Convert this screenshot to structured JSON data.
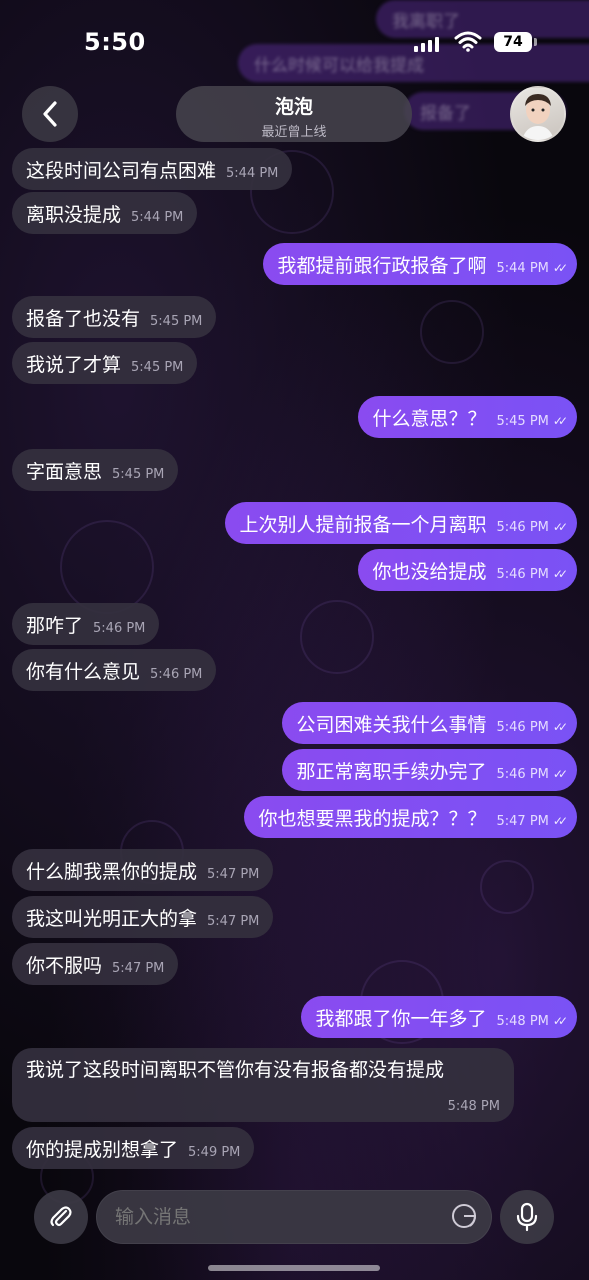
{
  "status": {
    "time": "5:50",
    "battery": "74"
  },
  "ghost_messages": [
    {
      "text": "我离职了"
    },
    {
      "text": "什么时候可以给我提成"
    },
    {
      "text": "报备了"
    }
  ],
  "header": {
    "name": "泡泡",
    "last_seen": "最近曾上线"
  },
  "messages": [
    {
      "side": "in",
      "text": "这段时间公司有点困难",
      "time": "5:44 PM"
    },
    {
      "side": "in",
      "text": "离职没提成",
      "time": "5:44 PM"
    },
    {
      "side": "out",
      "text": "我都提前跟行政报备了啊",
      "time": "5:44 PM"
    },
    {
      "side": "in",
      "text": "报备了也没有",
      "time": "5:45 PM"
    },
    {
      "side": "in",
      "text": "我说了才算",
      "time": "5:45 PM"
    },
    {
      "side": "out",
      "text": "什么意思？？",
      "time": "5:45 PM"
    },
    {
      "side": "in",
      "text": "字面意思",
      "time": "5:45 PM"
    },
    {
      "side": "out",
      "text": "上次别人提前报备一个月离职",
      "time": "5:46 PM"
    },
    {
      "side": "out",
      "text": "你也没给提成",
      "time": "5:46 PM"
    },
    {
      "side": "in",
      "text": "那咋了",
      "time": "5:46 PM"
    },
    {
      "side": "in",
      "text": "你有什么意见",
      "time": "5:46 PM"
    },
    {
      "side": "out",
      "text": "公司困难关我什么事情",
      "time": "5:46 PM"
    },
    {
      "side": "out",
      "text": "那正常离职手续办完了",
      "time": "5:46 PM"
    },
    {
      "side": "out",
      "text": "你也想要黑我的提成？？？",
      "time": "5:47 PM"
    },
    {
      "side": "in",
      "text": "什么脚我黑你的提成",
      "time": "5:47 PM"
    },
    {
      "side": "in",
      "text": "我这叫光明正大的拿",
      "time": "5:47 PM"
    },
    {
      "side": "in",
      "text": "你不服吗",
      "time": "5:47 PM"
    },
    {
      "side": "out",
      "text": "我都跟了你一年多了",
      "time": "5:48 PM"
    },
    {
      "side": "in",
      "text": "我说了这段时间离职不管你有没有报备都没有提成",
      "time": "5:48 PM"
    },
    {
      "side": "in",
      "text": "你的提成别想拿了",
      "time": "5:49 PM"
    }
  ],
  "composer": {
    "placeholder": "输入消息"
  },
  "icons": {
    "back": "chevron-left-icon",
    "attach": "paperclip-icon",
    "sticker": "sticker-icon",
    "mic": "microphone-icon",
    "read": "double-check-icon"
  },
  "colors": {
    "outgoing_bubble": "#8a4bf0",
    "incoming_bubble": "#34303e",
    "background": "#09070d"
  }
}
